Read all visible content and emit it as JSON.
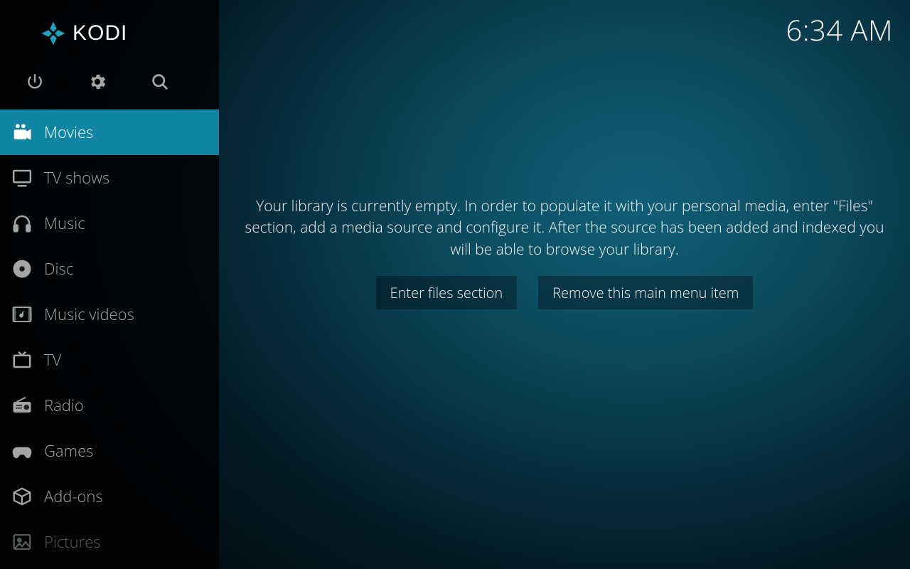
{
  "brand": "KODI",
  "clock": "6:34 AM",
  "topbar": {
    "power": "power-icon",
    "settings": "gear-icon",
    "search": "search-icon"
  },
  "sidebar": {
    "items": [
      {
        "id": "movies",
        "label": "Movies",
        "icon": "camera-icon",
        "selected": true
      },
      {
        "id": "tvshows",
        "label": "TV shows",
        "icon": "monitor-icon",
        "selected": false
      },
      {
        "id": "music",
        "label": "Music",
        "icon": "headphones-icon",
        "selected": false
      },
      {
        "id": "disc",
        "label": "Disc",
        "icon": "disc-icon",
        "selected": false
      },
      {
        "id": "musicvideos",
        "label": "Music videos",
        "icon": "musicvideo-icon",
        "selected": false
      },
      {
        "id": "tv",
        "label": "TV",
        "icon": "tv-icon",
        "selected": false
      },
      {
        "id": "radio",
        "label": "Radio",
        "icon": "radio-icon",
        "selected": false
      },
      {
        "id": "games",
        "label": "Games",
        "icon": "gamepad-icon",
        "selected": false
      },
      {
        "id": "addons",
        "label": "Add-ons",
        "icon": "box-icon",
        "selected": false
      },
      {
        "id": "pictures",
        "label": "Pictures",
        "icon": "image-icon",
        "selected": false,
        "faded": true
      }
    ]
  },
  "content": {
    "empty_message": "Your library is currently empty. In order to populate it with your personal media, enter \"Files\" section, add a media source and configure it. After the source has been added and indexed you will be able to browse your library.",
    "enter_files_label": "Enter files section",
    "remove_item_label": "Remove this main menu item"
  }
}
